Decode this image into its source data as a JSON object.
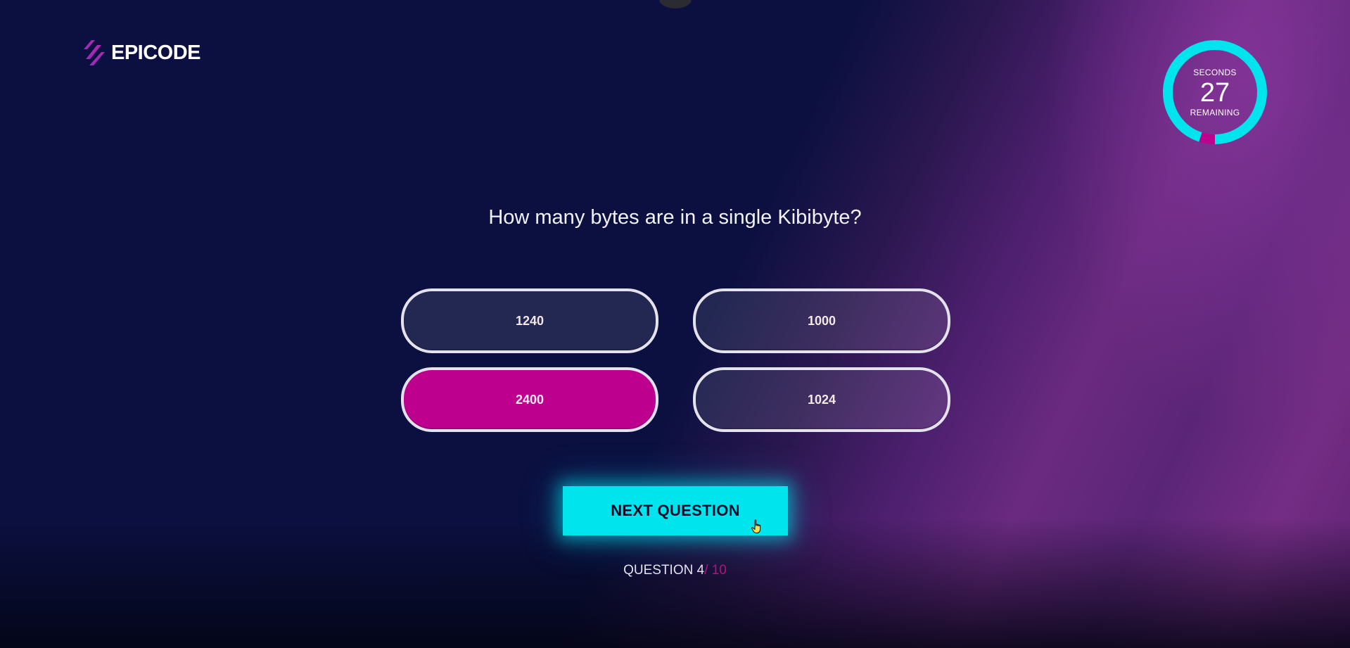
{
  "brand": {
    "name": "EPICODE",
    "accent": "#bd008e",
    "highlight": "#00e5ed"
  },
  "timer": {
    "top_label": "SECONDS",
    "value": "27",
    "bottom_label": "REMAINING",
    "remaining_fraction": 0.95,
    "ring_color": "#00e5ed",
    "elapsed_color": "#bd008e"
  },
  "quiz": {
    "question": "How many bytes are in a single Kibibyte?",
    "answers": [
      {
        "label": "1240",
        "selected": false
      },
      {
        "label": "1000",
        "selected": false
      },
      {
        "label": "2400",
        "selected": true
      },
      {
        "label": "1024",
        "selected": false
      }
    ],
    "next_label": "NEXT QUESTION",
    "progress": {
      "prefix": "QUESTION 4",
      "total": "/ 10"
    }
  },
  "icons": {
    "logo": "epicode-logo-icon",
    "cursor": "pointer-hand-icon"
  }
}
